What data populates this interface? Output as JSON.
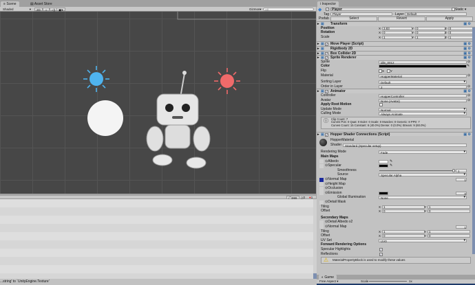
{
  "scene": {
    "tabs": [
      "Scene",
      "Asset Store"
    ],
    "shading": "Shaded",
    "mode_2d": "2D",
    "gizmos": "Gizmos",
    "search_placeholder": "All"
  },
  "console": {
    "log_count": "999",
    "warning_count": "0",
    "error_count": "1",
    "status_message": "...string' to `UnityEngine.Texture'"
  },
  "inspector": {
    "tab": "Inspector",
    "object_name": "Player",
    "static_label": "Static",
    "tag_label": "Tag",
    "tag_value": "Player",
    "layer_label": "Layer",
    "layer_value": "Default",
    "prefab_label": "Prefab",
    "prefab_buttons": [
      "Select",
      "Revert",
      "Apply"
    ],
    "rows": [
      {
        "k": "hdr",
        "label": "Transform"
      },
      {
        "k": "xyz",
        "label": "Position",
        "bold": true,
        "x": "3.83",
        "y": "0",
        "z": "0"
      },
      {
        "k": "xyz",
        "label": "Rotation",
        "bold": true,
        "x": "0",
        "y": "0",
        "z": "0"
      },
      {
        "k": "xyz",
        "label": "Scale",
        "x": "1",
        "y": "1",
        "z": "1"
      },
      {
        "k": "gap"
      },
      {
        "k": "hdr",
        "label": "Move Player (Script)",
        "check": true
      },
      {
        "k": "hdr",
        "label": "Rigidbody 2D"
      },
      {
        "k": "hdr",
        "label": "Box Collider 2D",
        "check": true
      },
      {
        "k": "hdr",
        "label": "Sprite Renderer",
        "check": true
      },
      {
        "k": "field",
        "label": "Sprite",
        "value": "idle_0012"
      },
      {
        "k": "field",
        "label": "Color",
        "bold": true,
        "style": "black",
        "value": ""
      },
      {
        "k": "flip",
        "label": "Flip",
        "x": "X",
        "y": "Y"
      },
      {
        "k": "field",
        "label": "Material",
        "value": "HopperMaterial"
      },
      {
        "k": "gap"
      },
      {
        "k": "field",
        "label": "Sorting Layer",
        "style": "dd",
        "value": "Default"
      },
      {
        "k": "field",
        "label": "Order in Layer",
        "value": "2"
      },
      {
        "k": "hdr",
        "label": "Animator",
        "check": true
      },
      {
        "k": "field",
        "label": "Controller",
        "value": "HopperController"
      },
      {
        "k": "field",
        "label": "Avatar",
        "value": "None (Avatar)"
      },
      {
        "k": "check",
        "label": "Apply Root Motion",
        "bold": true,
        "checked": false
      },
      {
        "k": "field",
        "label": "Update Mode",
        "style": "dd",
        "value": "Normal"
      },
      {
        "k": "field",
        "label": "Culling Mode",
        "style": "dd",
        "value": "Always Animate"
      },
      {
        "k": "info",
        "lines": [
          "Clip Count: 7",
          "Curves Pos: 0 Quat: 0 Euler: 0 Scale: 0 Muscles: 0 Generic: 8 PPtr: 7",
          "Curves Count: 15 Constant: 6 (40.0%) Dense: 0 (0.0%) Stream: 9 (60.0%)"
        ]
      },
      {
        "k": "gap"
      },
      {
        "k": "hdr",
        "label": "Hopper Shader Connections (Script)",
        "check": true
      },
      {
        "k": "gap"
      },
      {
        "k": "mat",
        "label": "HopperMaterial",
        "shader_label": "Shader",
        "shader": "Standard (Specular setup)"
      },
      {
        "k": "gap"
      },
      {
        "k": "field",
        "label": "Rendering Mode",
        "style": "dd",
        "value": "Fade"
      },
      {
        "k": "plain",
        "label": "Main Maps",
        "bold": true
      },
      {
        "k": "field",
        "label": "⊙Albedo",
        "style": "white",
        "value": "",
        "tex": true
      },
      {
        "k": "field",
        "label": "⊙Specular",
        "style": "blk",
        "value": "",
        "tex": true
      },
      {
        "k": "slider",
        "label": "Smoothness",
        "value": "1"
      },
      {
        "k": "field",
        "label": "Source",
        "style": "dd",
        "value": "Specular Alpha",
        "indent": true
      },
      {
        "k": "num",
        "label": "⊙Normal Map",
        "value": "1",
        "tex": true,
        "blue": true
      },
      {
        "k": "plain",
        "label": "⊙Height Map",
        "tex": true
      },
      {
        "k": "plain",
        "label": "⊙Occlusion",
        "tex": true
      },
      {
        "k": "emis",
        "label": "⊙Emission",
        "value": "0",
        "tex": true
      },
      {
        "k": "field",
        "label": "Global Illumination",
        "style": "dd",
        "value": "None",
        "indent": true
      },
      {
        "k": "plain",
        "label": "⊙Detail Mask",
        "tex": true
      },
      {
        "k": "xy",
        "label": "Tiling",
        "x": "1",
        "y": "1"
      },
      {
        "k": "xy",
        "label": "Offset",
        "x": "0",
        "y": "0"
      },
      {
        "k": "gap"
      },
      {
        "k": "plain",
        "label": "Secondary Maps",
        "bold": true
      },
      {
        "k": "plain",
        "label": "⊙Detail Albedo x2",
        "tex": true
      },
      {
        "k": "num",
        "label": "⊙Normal Map",
        "value": "1",
        "tex": true
      },
      {
        "k": "xy",
        "label": "Tiling",
        "x": "1",
        "y": "1"
      },
      {
        "k": "xy",
        "label": "Offset",
        "x": "0",
        "y": "0"
      },
      {
        "k": "field",
        "label": "UV Set",
        "style": "dd",
        "value": "UV0"
      },
      {
        "k": "plain",
        "label": "Forward Rendering Options",
        "bold": true
      },
      {
        "k": "check",
        "label": "Specular Highlights",
        "checked": true
      },
      {
        "k": "check",
        "label": "Reflections",
        "checked": true
      },
      {
        "k": "warn",
        "text": "MaterialPropertyBlock is used to modify these values"
      }
    ]
  },
  "game": {
    "tab": "Game",
    "aspect": "Free Aspect",
    "scale_label": "Scale",
    "scale_value": "1x"
  },
  "colors": {
    "sun_blue": "#4fb3ee",
    "sun_red": "#f06a6a",
    "scene_bg": "#474747"
  }
}
